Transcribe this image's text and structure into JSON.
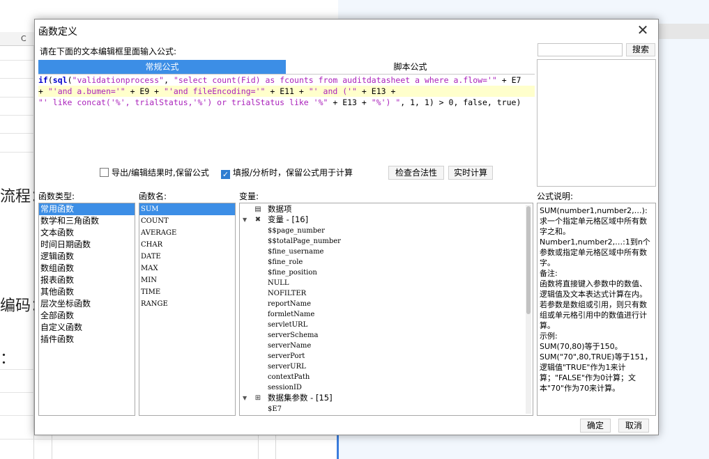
{
  "background": {
    "column_header": [
      "C"
    ],
    "partial_texts": [
      "流程：",
      "编码：",
      "："
    ]
  },
  "dialog": {
    "title": "函数定义",
    "close_glyph": "✕",
    "prompt": "请在下面的文本编辑框里面输入公式:",
    "tabs": [
      "常规公式",
      "脚本公式"
    ],
    "search": {
      "value": "",
      "button": "搜索"
    },
    "formula_lines": [
      [
        {
          "t": "if",
          "c": "k"
        },
        {
          "t": "(",
          "c": "p"
        },
        {
          "t": "sql",
          "c": "k"
        },
        {
          "t": "(",
          "c": "p"
        },
        {
          "t": "\"validationprocess\"",
          "c": "s"
        },
        {
          "t": ", ",
          "c": "p"
        },
        {
          "t": "\"select count(Fid) as fcounts from auditdatasheet a where a.flow='\"",
          "c": "s"
        },
        {
          "t": " + E7",
          "c": "p"
        }
      ],
      [
        {
          "t": "+ ",
          "c": "p"
        },
        {
          "t": "\"'and a.bumen='\"",
          "c": "s"
        },
        {
          "t": " + E9 + ",
          "c": "p"
        },
        {
          "t": "\"'and fileEncoding='\"",
          "c": "s"
        },
        {
          "t": " + E11 + ",
          "c": "p"
        },
        {
          "t": "\"' and ('\"",
          "c": "s"
        },
        {
          "t": " + E13 +",
          "c": "p"
        }
      ],
      [
        {
          "t": "\"' like concat('%', trialStatus,'%') or trialStatus like '%\"",
          "c": "s"
        },
        {
          "t": " + E13 + ",
          "c": "p"
        },
        {
          "t": "\"%') \"",
          "c": "s"
        },
        {
          "t": ", 1, 1) > 0, false, true)",
          "c": "p"
        }
      ]
    ],
    "options": {
      "keep_formula_export": {
        "label": "导出/编辑结果时,保留公式",
        "checked": false
      },
      "keep_formula_fill": {
        "label": "填报/分析时，保留公式用于计算",
        "checked": true
      }
    },
    "check_button": "检查合法性",
    "calc_button": "实时计算",
    "labels": {
      "function_type": "函数类型:",
      "function_name": "函数名:",
      "variables": "变量:",
      "description": "公式说明:"
    },
    "function_types": [
      "常用函数",
      "数学和三角函数",
      "文本函数",
      "时间日期函数",
      "逻辑函数",
      "数组函数",
      "报表函数",
      "其他函数",
      "层次坐标函数",
      "全部函数",
      "自定义函数",
      "插件函数"
    ],
    "function_names": [
      "SUM",
      "COUNT",
      "AVERAGE",
      "CHAR",
      "DATE",
      "MAX",
      "MIN",
      "TIME",
      "RANGE"
    ],
    "variables": {
      "data_items": "数据项",
      "variable_group": "变量 - [16]",
      "variable_items": [
        "$$page_number",
        "$$totalPage_number",
        "$fine_username",
        "$fine_role",
        "$fine_position",
        "NULL",
        "NOFILTER",
        "reportName",
        "formletName",
        "servletURL",
        "serverSchema",
        "serverName",
        "serverPort",
        "serverURL",
        "contextPath",
        "sessionID"
      ],
      "dataset_group": "数据集参数 - [15]",
      "dataset_items": [
        "$E7"
      ]
    },
    "description": [
      "SUM(number1,number2,…):求一个指定单元格区域中所有数字之和。",
      "Number1,number2,…:1到n个参数或指定单元格区域中所有数字。",
      "备注:",
      "函数将直接键入参数中的数值、逻辑值及文本表达式计算在内。若参数是数组或引用，则只有数组或单元格引用中的数值进行计算。",
      "示例:",
      "SUM(70,80)等于150。",
      "SUM(\"70\",80,TRUE)等于151，逻辑值\"TRUE\"作为1来计算；\"FALSE\"作为0计算；文本\"70\"作为70来计算。"
    ],
    "ok_button": "确定",
    "cancel_button": "取消"
  }
}
